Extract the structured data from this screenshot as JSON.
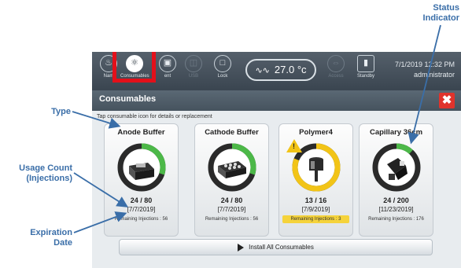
{
  "callouts": {
    "status_line1": "Status",
    "status_line2": "Indicator",
    "type": "Type",
    "usage_line1": "Usage Count",
    "usage_line2": "(Injections)",
    "expiration_line1": "Expiration",
    "expiration_line2": "Date"
  },
  "topbar": {
    "items": [
      {
        "label": "Nam",
        "icon": "bell-icon"
      },
      {
        "label": "Consumables",
        "icon": "flask-icon"
      },
      {
        "label": "ent",
        "icon": "cabinet-icon"
      },
      {
        "label": "USB",
        "icon": "usb-icon"
      },
      {
        "label": "Lock",
        "icon": "lock-icon"
      },
      {
        "label": "Access",
        "icon": "access-icon"
      },
      {
        "label": "Standby",
        "icon": "standby-icon"
      }
    ],
    "temperature": "27.0 °c",
    "datetime": "7/1/2019 12:32 PM",
    "user": "administrator"
  },
  "panel": {
    "title": "Consumables",
    "hint": "Tap consumable icon for details or replacement",
    "install_label": "Install All Consumables"
  },
  "cards": [
    {
      "name": "Anode Buffer",
      "count": "24 / 80",
      "date": "[7/7/2019]",
      "remaining": "Remaining Injections : 56",
      "fraction": 0.3,
      "ring_color": "#4cb848",
      "icon": "anode-buffer-icon",
      "warning": false
    },
    {
      "name": "Cathode Buffer",
      "count": "24 / 80",
      "date": "[7/7/2019]",
      "remaining": "Remaining Injections : 56",
      "fraction": 0.3,
      "ring_color": "#4cb848",
      "icon": "cathode-buffer-icon",
      "warning": false
    },
    {
      "name": "Polymer4",
      "count": "13 / 16",
      "date": "[7/9/2019]",
      "remaining": "Remaining Injections : 3",
      "fraction": 0.81,
      "ring_color": "#f2c417",
      "icon": "polymer-icon",
      "warning": true
    },
    {
      "name": "Capillary 36cm",
      "count": "24 / 200",
      "date": "[11/23/2019]",
      "remaining": "Remaining Injections : 176",
      "fraction": 0.12,
      "ring_color": "#4cb848",
      "icon": "capillary-icon",
      "warning": false
    }
  ],
  "colors": {
    "accent": "#3a6ea8",
    "highlight": "#e3101a",
    "ok": "#4cb848",
    "warning": "#f2c417"
  }
}
